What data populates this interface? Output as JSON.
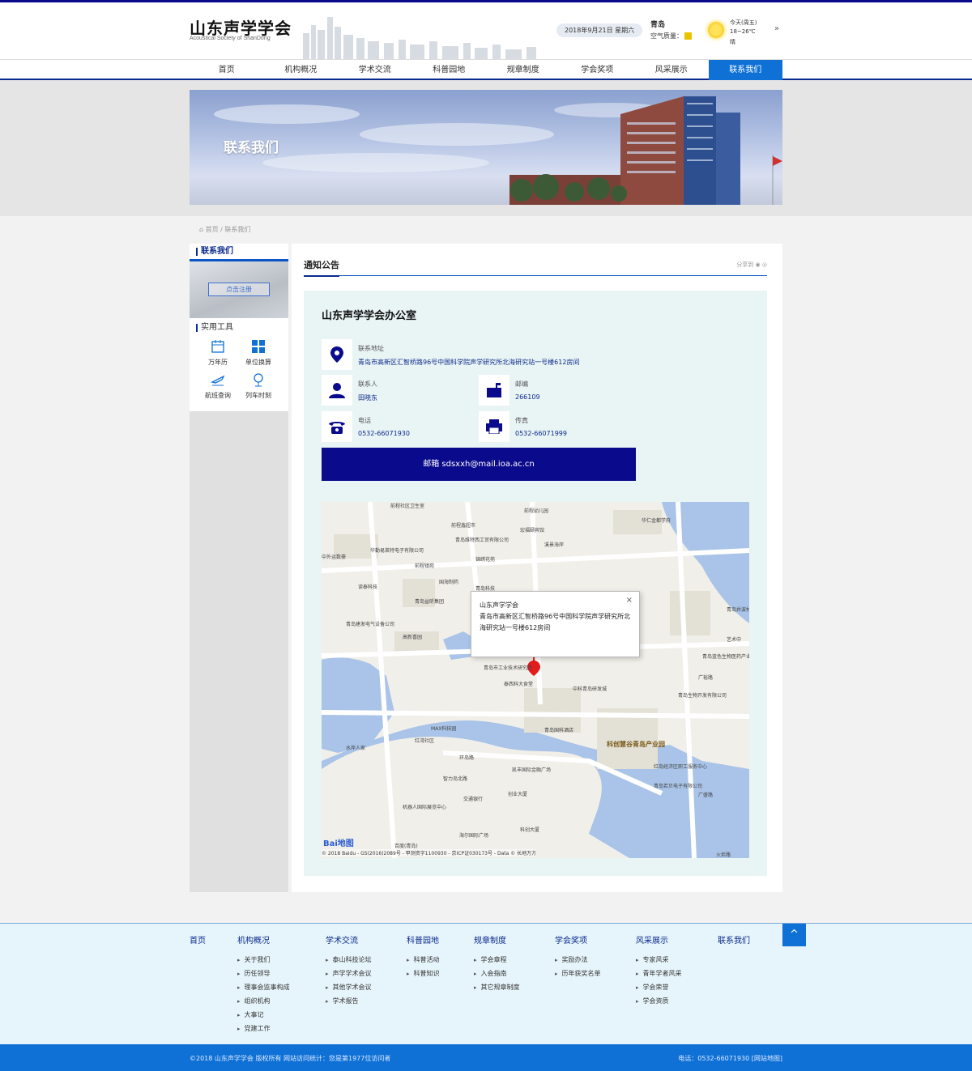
{
  "header": {
    "logo_cn": "山东声学学会",
    "logo_en": "Acoustical Society of ShanDong",
    "date": "2018年9月21日 星期六",
    "city": "青岛",
    "air_quality_label": "空气质量：",
    "weather_day": "今天(周五)",
    "weather_temp": "18~26℃",
    "weather_desc": "晴",
    "more": "»"
  },
  "nav": {
    "items": [
      "首页",
      "机构概况",
      "学术交流",
      "科普园地",
      "规章制度",
      "学会奖项",
      "风采展示",
      "联系我们"
    ],
    "active": "联系我们"
  },
  "banner": {
    "title": "联系我们"
  },
  "breadcrumb": "首页 / 联系我们",
  "sidebar": {
    "title": "联系我们",
    "register_label": "点击注册",
    "tools_title": "实用工具",
    "tools": [
      "万年历",
      "单位换算",
      "航班查询",
      "列车时刻"
    ]
  },
  "main": {
    "title": "通知公告",
    "share_label": "分享到",
    "office": "山东声学学会办公室",
    "address_label": "联系地址",
    "address": "青岛市高新区汇智桥路96号中国科学院声学研究所北海研究站一号楼612房间",
    "contact_label": "联系人",
    "contact": "田晓东",
    "postcode_label": "邮编",
    "postcode": "266109",
    "phone_label": "电话",
    "phone": "0532-66071930",
    "fax_label": "传真",
    "fax": "0532-66071999",
    "email": "邮箱 sdsxxh@mail.ioa.ac.cn"
  },
  "map": {
    "popup_title": "山东声学学会",
    "popup_address": "青岛市高新区汇智桥路96号中国科学院声学研究所北海研究站一号楼612房间",
    "close": "×",
    "logo": "Bai地图",
    "copyright": "© 2018 Baidu - GS(2016)2089号 - 甲测资字1100930 - 京ICP证030173号 - Data © 长地万方",
    "labels": [
      "前程社区卫生室",
      "前程幼儿园",
      "前程鑫超市",
      "宏福颐宾馆",
      "青岛维特西工贸有限公司",
      "锦绣花苑",
      "溪景海岸",
      "华仁金都学府",
      "华勤易莱特电子有限公司",
      "中外运数豪",
      "前程镇苑",
      "国海制药",
      "青岛科技",
      "读泰科技",
      "青岛益昕集团",
      "青岛建发电气设备公司",
      "高新喜园",
      "青岛市工业技术研究院",
      "泰西科大食堂",
      "中科青岛研发城",
      "青岛生物开发有限公司",
      "青岛蓝色生物医药产业园",
      "广裕路",
      "MAX科技园",
      "红湾社区",
      "水岸人家",
      "青岛国科酒店",
      "科创慧谷青岛产业园",
      "红岛经济区职工服务中心",
      "青岛若贝电子有限公司",
      "广盛路",
      "环岛路",
      "智力岛北路",
      "凯丰国际金融广场",
      "交通银行",
      "创业大厦",
      "机器人国际展览中心",
      "海尔国际广场",
      "科创大厦",
      "百度(青岛)",
      "火炬路",
      "艺术中",
      "青岛井波材料"
    ]
  },
  "footer": {
    "columns": [
      {
        "title": "首页",
        "items": []
      },
      {
        "title": "机构概况",
        "items": [
          "关于我们",
          "历任领导",
          "理事会监事构成",
          "组织机构",
          "大事记",
          "党建工作"
        ]
      },
      {
        "title": "学术交流",
        "items": [
          "泰山科技论坛",
          "声学学术会议",
          "其他学术会议",
          "学术报告"
        ]
      },
      {
        "title": "科普园地",
        "items": [
          "科普活动",
          "科普知识"
        ]
      },
      {
        "title": "规章制度",
        "items": [
          "学会章程",
          "入会指南",
          "其它规章制度"
        ]
      },
      {
        "title": "学会奖项",
        "items": [
          "奖励办法",
          "历年获奖名单"
        ]
      },
      {
        "title": "风采展示",
        "items": [
          "专家风采",
          "青年学者风采",
          "学会荣誉",
          "学会资质"
        ]
      },
      {
        "title": "联系我们",
        "items": []
      }
    ],
    "to_top": "^"
  },
  "copyright": {
    "left": "©2018 山东声学学会 版权所有 网站访问统计：您是第1977位访问者",
    "right": "电话：0532-66071930 [网站地图]"
  },
  "colors": {
    "brand_navy": "#0a0a8c",
    "accent_blue": "#0f71d6"
  }
}
